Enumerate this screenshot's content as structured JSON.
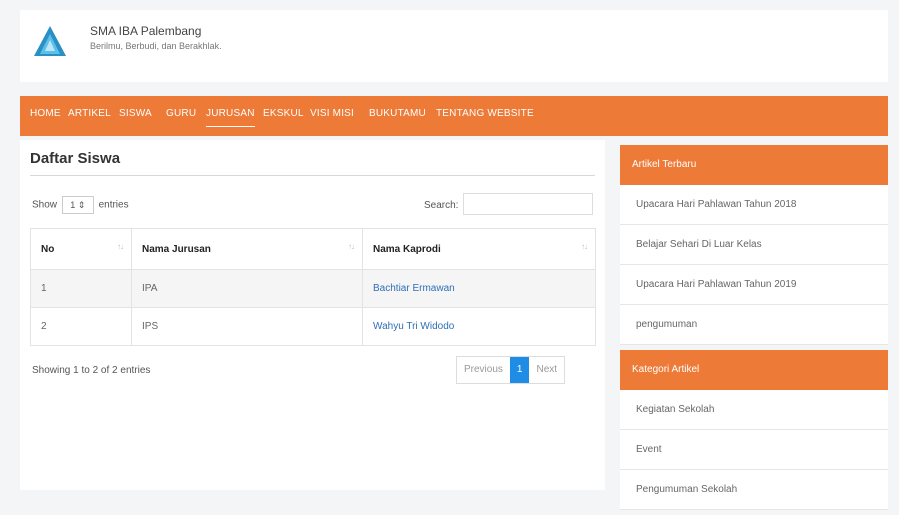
{
  "header": {
    "school_name": "SMA IBA Palembang",
    "tagline": "Berilmu, Berbudi, dan Berakhlak."
  },
  "nav": {
    "items": [
      "HOME",
      "ARTIKEL",
      "SISWA",
      "GURU",
      "JURUSAN",
      "EKSKUL",
      "VISI MISI",
      "BUKUTAMU",
      "TENTANG WEBSITE"
    ],
    "active": "JURUSAN"
  },
  "main": {
    "title": "Daftar Siswa",
    "show_label": "Show",
    "length_value": "1",
    "entries_label": "entries",
    "search_label": "Search:",
    "search_value": "",
    "columns": [
      "No",
      "Nama Jurusan",
      "Nama Kaprodi"
    ],
    "rows": [
      {
        "no": "1",
        "jurusan": "IPA",
        "kaprodi": "Bachtiar Ermawan"
      },
      {
        "no": "2",
        "jurusan": "IPS",
        "kaprodi": "Wahyu Tri Widodo"
      }
    ],
    "info": "Showing 1 to 2 of 2 entries",
    "pager": {
      "previous": "Previous",
      "current": "1",
      "next": "Next"
    }
  },
  "sidebar": {
    "latest_title": "Artikel Terbaru",
    "latest": [
      "Upacara Hari Pahlawan Tahun 2018",
      "Belajar Sehari Di Luar Kelas",
      "Upacara Hari Pahlawan Tahun 2019",
      "pengumuman"
    ],
    "category_title": "Kategori Artikel",
    "categories": [
      "Kegiatan Sekolah",
      "Event",
      "Pengumuman Sekolah"
    ]
  },
  "colors": {
    "accent": "#ee7a38",
    "pager_active": "#1f8ce6",
    "link": "#2f6fb5"
  }
}
